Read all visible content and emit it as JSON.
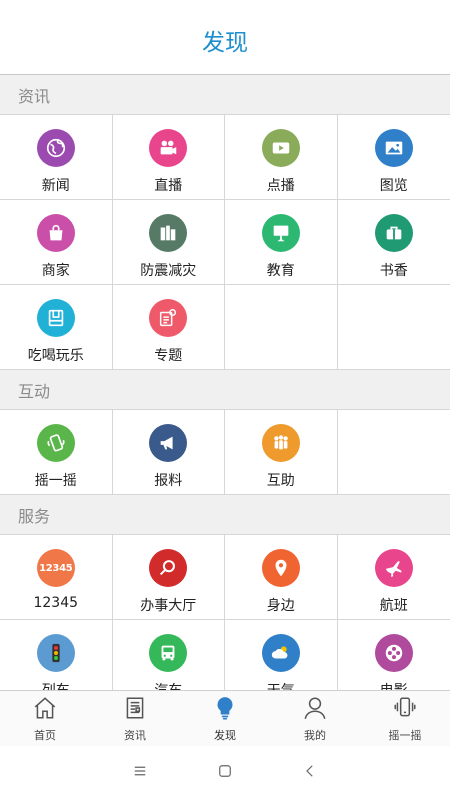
{
  "header": {
    "title": "发现"
  },
  "sections": [
    {
      "title": "资讯",
      "items": [
        {
          "label": "新闻",
          "icon": "globe-icon",
          "color": "#9b4bb0"
        },
        {
          "label": "直播",
          "icon": "video-camera-icon",
          "color": "#e8458c"
        },
        {
          "label": "点播",
          "icon": "play-icon",
          "color": "#8aab5a"
        },
        {
          "label": "图览",
          "icon": "picture-icon",
          "color": "#2f7fc9"
        },
        {
          "label": "商家",
          "icon": "shopping-bag-icon",
          "color": "#c94fa8"
        },
        {
          "label": "防震减灾",
          "icon": "buildings-icon",
          "color": "#567a66"
        },
        {
          "label": "教育",
          "icon": "blackboard-icon",
          "color": "#2db872"
        },
        {
          "label": "书香",
          "icon": "book-bag-icon",
          "color": "#1f9a73"
        },
        {
          "label": "吃喝玩乐",
          "icon": "food-box-icon",
          "color": "#22b1d6"
        },
        {
          "label": "专题",
          "icon": "topic-icon",
          "color": "#ef5a6a"
        }
      ]
    },
    {
      "title": "互动",
      "items": [
        {
          "label": "摇一摇",
          "icon": "shake-phone-icon",
          "color": "#5ab54a"
        },
        {
          "label": "报料",
          "icon": "megaphone-icon",
          "color": "#3a5a8c"
        },
        {
          "label": "互助",
          "icon": "people-icon",
          "color": "#ef9a2c"
        }
      ]
    },
    {
      "title": "服务",
      "items": [
        {
          "label": "12345",
          "icon": "hotline-12345-icon",
          "iconText": "12345",
          "color": "#f07848"
        },
        {
          "label": "办事大厅",
          "icon": "search-icon",
          "color": "#d22b2b"
        },
        {
          "label": "身边",
          "icon": "location-pin-icon",
          "color": "#f06432"
        },
        {
          "label": "航班",
          "icon": "airplane-icon",
          "color": "#e8458c"
        },
        {
          "label": "列车",
          "icon": "traffic-light-icon",
          "color": "#5b9bd1"
        },
        {
          "label": "汽车",
          "icon": "bus-icon",
          "color": "#35b85a"
        },
        {
          "label": "天气",
          "icon": "weather-icon",
          "color": "#2f7fc9"
        },
        {
          "label": "电影",
          "icon": "film-reel-icon",
          "color": "#b04a9c"
        }
      ]
    }
  ],
  "tabbar": [
    {
      "label": "首页",
      "icon": "home-icon",
      "active": false
    },
    {
      "label": "资讯",
      "icon": "news-icon",
      "active": false
    },
    {
      "label": "发现",
      "icon": "lightbulb-icon",
      "active": true
    },
    {
      "label": "我的",
      "icon": "user-icon",
      "active": false
    },
    {
      "label": "摇一摇",
      "icon": "shake-icon",
      "active": false
    }
  ],
  "system_nav": [
    {
      "icon": "menu-icon"
    },
    {
      "icon": "home-square-icon"
    },
    {
      "icon": "back-icon"
    }
  ],
  "colors": {
    "accent": "#1d8fcf",
    "active_tab": "#2f7fc9"
  }
}
